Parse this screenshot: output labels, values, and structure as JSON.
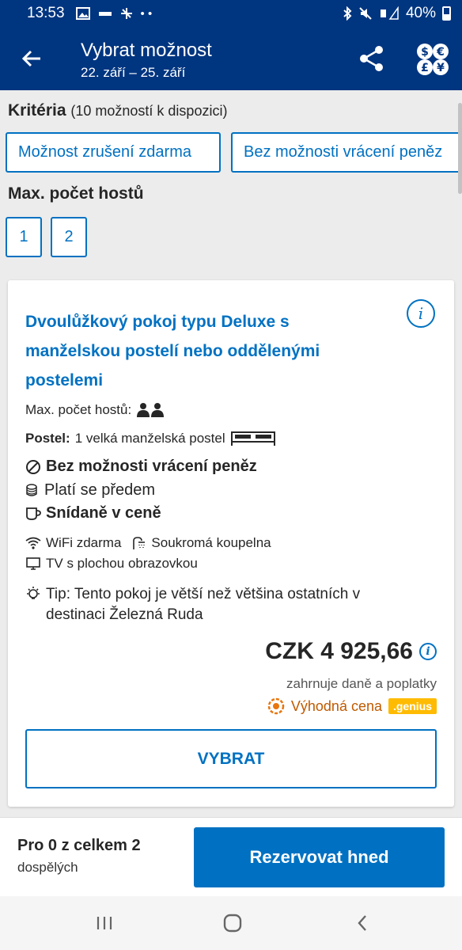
{
  "status_bar": {
    "time": "13:53",
    "battery": "40%"
  },
  "header": {
    "title": "Vybrat možnost",
    "dates": "22. září – 25. září"
  },
  "criteria": {
    "title": "Kritéria",
    "count": "(10 možností k dispozici)",
    "chips": [
      "Možnost zrušení zdarma",
      "Bez možnosti vrácení peněz"
    ]
  },
  "guests": {
    "title": "Max. počet hostů",
    "options": [
      "1",
      "2"
    ]
  },
  "room": {
    "name": "Dvoulůžkový pokoj typu Deluxe s manželskou postelí nebo oddělenými postelemi",
    "max_guests_label": "Max. počet hostů:",
    "bed_label": "Postel:",
    "bed_value": "1 velká manželská postel",
    "policy": "Bez možnosti vrácení peněz",
    "payment": "Platí se předem",
    "breakfast": "Snídaně v ceně",
    "amenity_wifi": "WiFi zdarma",
    "amenity_bathroom": "Soukromá koupelna",
    "amenity_tv": "TV s plochou obrazovkou",
    "tip": "Tip: Tento pokoj je větší než většina ostatních v destinaci Železná Ruda",
    "price": "CZK 4 925,66",
    "taxes": "zahrnuje daně a poplatky",
    "deal_label": "Výhodná cena",
    "genius_badge": ".genius",
    "select_button": "VYBRAT"
  },
  "booking_bar": {
    "for_count": "Pro 0 z celkem 2",
    "adults": "dospělých",
    "reserve_button": "Rezervovat hned"
  },
  "colors": {
    "brand_dark": "#003580",
    "brand_blue": "#0071c2",
    "genius_yellow": "#febb02",
    "deal_orange": "#c05a00"
  }
}
